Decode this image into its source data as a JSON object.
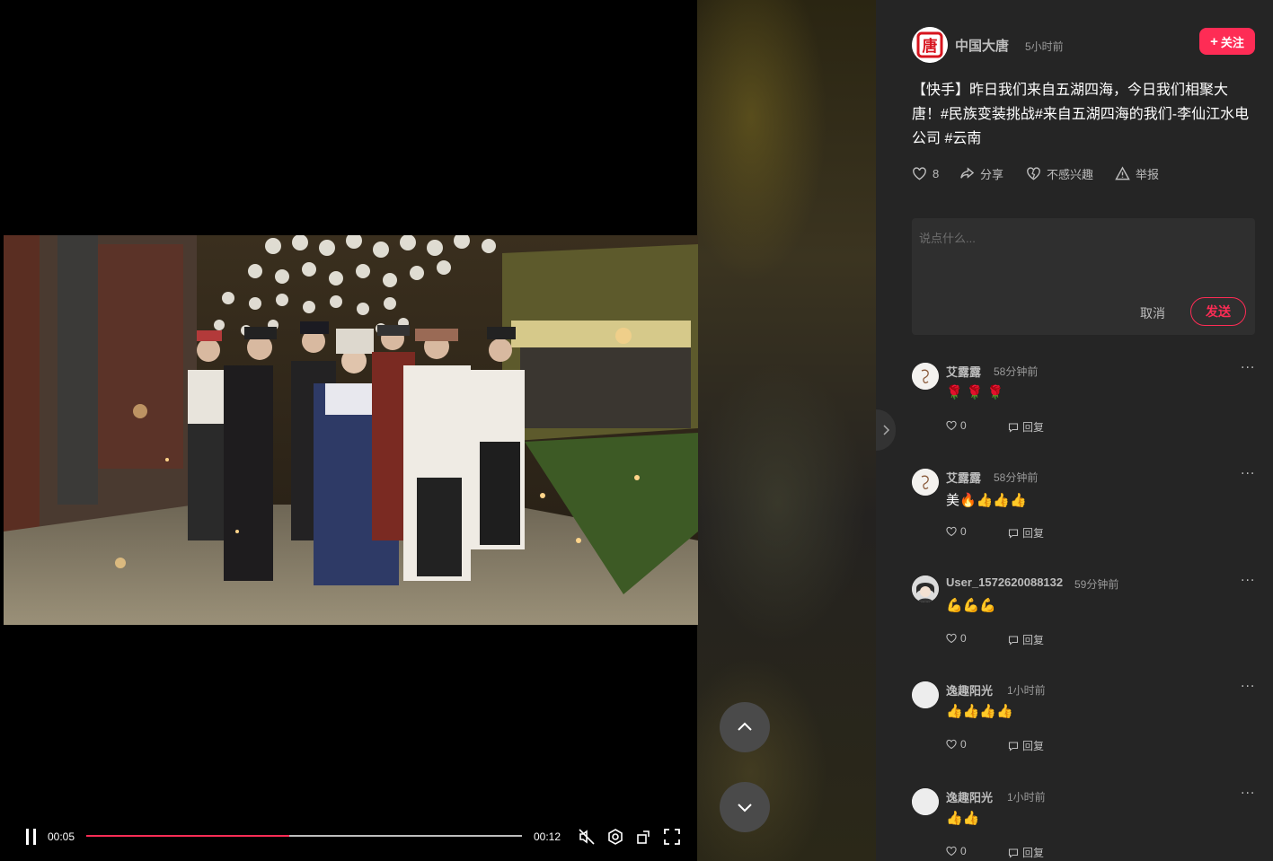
{
  "video": {
    "current_time": "00:05",
    "duration": "00:12",
    "progress_fraction": 0.465
  },
  "author": {
    "name": "中国大唐",
    "time": "5小时前",
    "follow_label": "关注",
    "avatar_char": "唐"
  },
  "caption": "【快手】昨日我们来自五湖四海，今日我们相聚大唐！#民族变装挑战#来自五湖四海的我们-李仙江水电公司 #云南",
  "actions": {
    "like_count": "8",
    "share_label": "分享",
    "dislike_label": "不感兴趣",
    "report_label": "举报"
  },
  "comment_box": {
    "placeholder": "说点什么...",
    "cancel_label": "取消",
    "send_label": "发送"
  },
  "comments": [
    {
      "user": "艾露露",
      "time": "58分钟前",
      "text": "🌹 🌹 🌹",
      "likes": "0",
      "reply_label": "回复"
    },
    {
      "user": "艾露露",
      "time": "58分钟前",
      "text": "美🔥👍👍👍",
      "likes": "0",
      "reply_label": "回复"
    },
    {
      "user": "User_1572620088132",
      "time": "59分钟前",
      "text": "💪💪💪",
      "likes": "0",
      "reply_label": "回复"
    },
    {
      "user": "逸趣阳光",
      "time": "1小时前",
      "text": "👍👍👍👍",
      "likes": "0",
      "reply_label": "回复"
    },
    {
      "user": "逸趣阳光",
      "time": "1小时前",
      "text": "👍👍",
      "likes": "0",
      "reply_label": "回复"
    }
  ],
  "colors": {
    "accent": "#fe2c55",
    "panel_bg": "#252525",
    "text_muted": "#bdbdbd"
  }
}
